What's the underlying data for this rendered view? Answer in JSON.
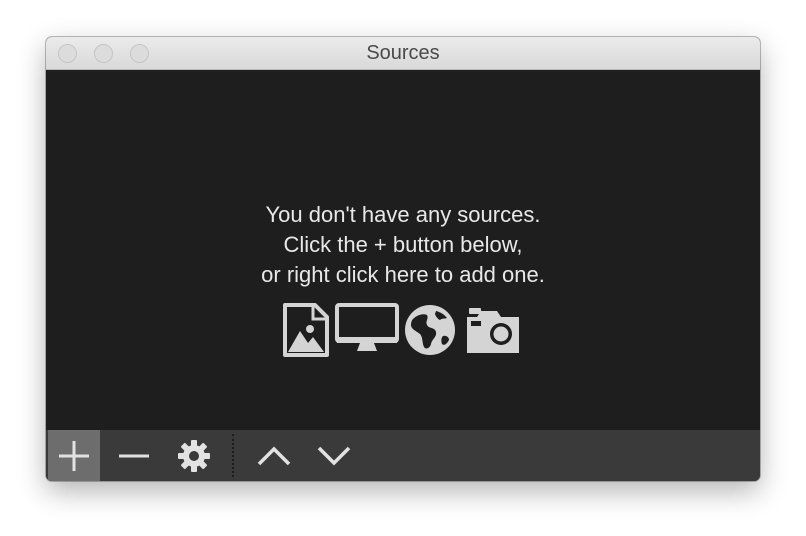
{
  "window": {
    "title": "Sources"
  },
  "empty_state": {
    "line1": "You don't have any sources.",
    "line2": "Click the + button below,",
    "line3": "or right click here to add one.",
    "icons": [
      "image-icon",
      "display-icon",
      "globe-icon",
      "camera-icon"
    ]
  },
  "toolbar": {
    "buttons": [
      "add-icon",
      "remove-icon",
      "gear-icon",
      "chevron-up-icon",
      "chevron-down-icon"
    ]
  },
  "colors": {
    "content_bg": "#1e1e1e",
    "toolbar_bg": "#3a3a3a",
    "active_button_bg": "#6d6d6d",
    "icon_color": "#d4d4d4"
  }
}
